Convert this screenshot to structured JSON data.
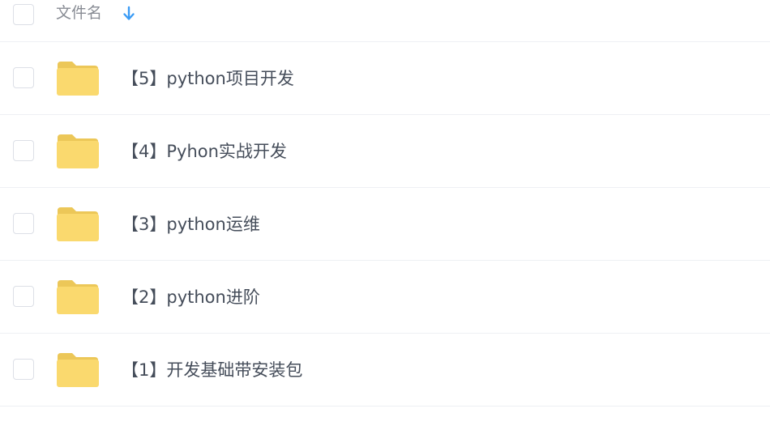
{
  "header": {
    "column_label": "文件名",
    "sort_icon": "arrow-down-icon"
  },
  "colors": {
    "folder": "#fad96e",
    "folder_tab": "#ecc758",
    "sort_arrow": "#3a9bf5",
    "text": "#454d5a",
    "divider": "#eef0f4"
  },
  "files": [
    {
      "name": "【5】python项目开发",
      "icon": "folder-icon"
    },
    {
      "name": "【4】Pyhon实战开发",
      "icon": "folder-icon"
    },
    {
      "name": "【3】python运维",
      "icon": "folder-icon"
    },
    {
      "name": "【2】python进阶",
      "icon": "folder-icon"
    },
    {
      "name": "【1】开发基础带安装包",
      "icon": "folder-icon"
    }
  ]
}
